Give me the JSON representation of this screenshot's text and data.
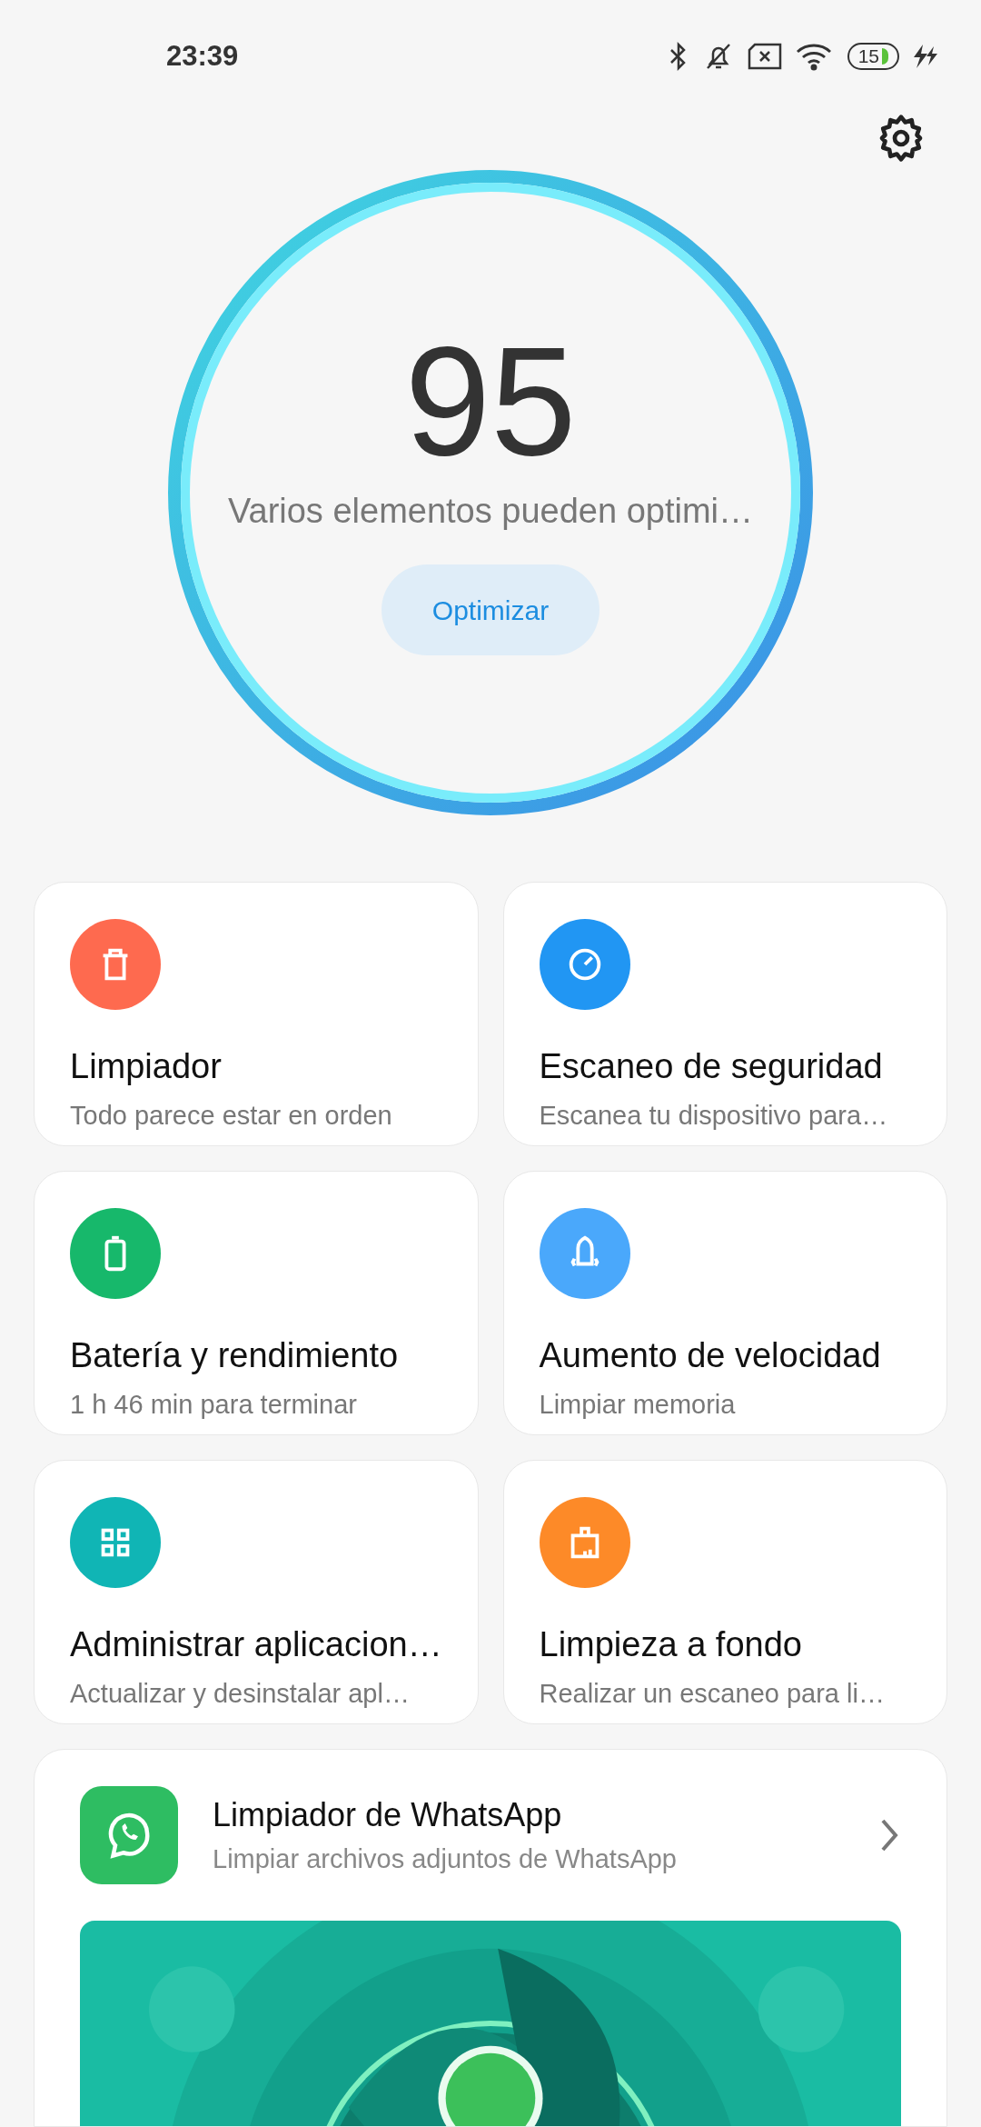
{
  "status_bar": {
    "time": "23:39",
    "battery": "15"
  },
  "score": {
    "value": "95",
    "message": "Varios elementos pueden optimi…",
    "button": "Optimizar"
  },
  "tiles": [
    {
      "title": "Limpiador",
      "subtitle": "Todo parece estar en orden",
      "color": "#fe6a4f"
    },
    {
      "title": "Escaneo de seguridad",
      "subtitle": "Escanea tu dispositivo para…",
      "color": "#2196f3"
    },
    {
      "title": "Batería y rendimiento",
      "subtitle": "1 h 46 min  para terminar",
      "color": "#17b86b"
    },
    {
      "title": "Aumento de velocidad",
      "subtitle": "Limpiar memoria",
      "color": "#4aa8fb"
    },
    {
      "title": "Administrar aplicacion…",
      "subtitle": "Actualizar y desinstalar apl…",
      "color": "#10b5b5"
    },
    {
      "title": "Limpieza a fondo",
      "subtitle": "Realizar un escaneo para li…",
      "color": "#fd8a28"
    }
  ],
  "whatsapp_card": {
    "title": "Limpiador de WhatsApp",
    "subtitle": "Limpiar archivos adjuntos de WhatsApp"
  }
}
